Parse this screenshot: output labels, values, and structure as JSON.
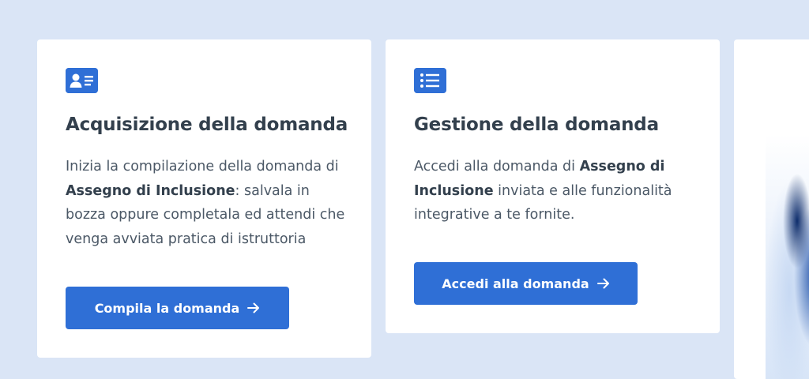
{
  "cards": [
    {
      "icon": "id-card-icon",
      "title": "Acquisizione della domanda",
      "text_parts": [
        "Inizia la compilazione della domanda di ",
        "Assegno di Inclusione",
        ": salvala in bozza oppure completala ed attendi che venga avviata pratica di istruttoria"
      ],
      "button_label": "Compila la domanda"
    },
    {
      "icon": "list-icon",
      "title": "Gestione della domanda",
      "text_parts": [
        "Accedi alla domanda di ",
        "Assegno di Inclusione",
        " inviata e alle funzionalità integrative a te fornite."
      ],
      "button_label": "Accedi alla domanda"
    }
  ],
  "colors": {
    "background": "#dae5f6",
    "card": "#ffffff",
    "accent": "#2f6fd6",
    "title": "#33404d",
    "body_text": "#4b5866"
  }
}
